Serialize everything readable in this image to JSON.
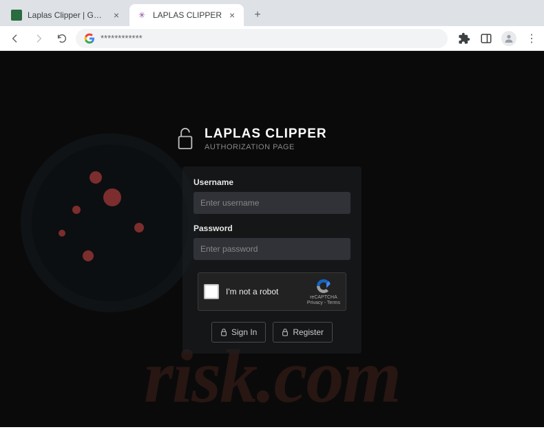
{
  "window": {
    "controls": {
      "chevron": "⌄",
      "min": "—",
      "max": "☐",
      "close": "✕"
    }
  },
  "tabs": [
    {
      "title": "Laplas Clipper | GENERATION OF",
      "active": false,
      "favicon": "green"
    },
    {
      "title": "LAPLAS CLIPPER",
      "active": true,
      "favicon": "bug"
    }
  ],
  "toolbar": {
    "url_display": "************"
  },
  "page": {
    "header": {
      "title": "LAPLAS CLIPPER",
      "subtitle": "AUTHORIZATION PAGE"
    },
    "form": {
      "username_label": "Username",
      "username_placeholder": "Enter username",
      "password_label": "Password",
      "password_placeholder": "Enter password"
    },
    "recaptcha": {
      "label": "I'm not a robot",
      "brand": "reCAPTCHA",
      "terms": "Privacy - Terms"
    },
    "buttons": {
      "signin": "Sign In",
      "register": "Register"
    },
    "watermark": "risk.com"
  }
}
